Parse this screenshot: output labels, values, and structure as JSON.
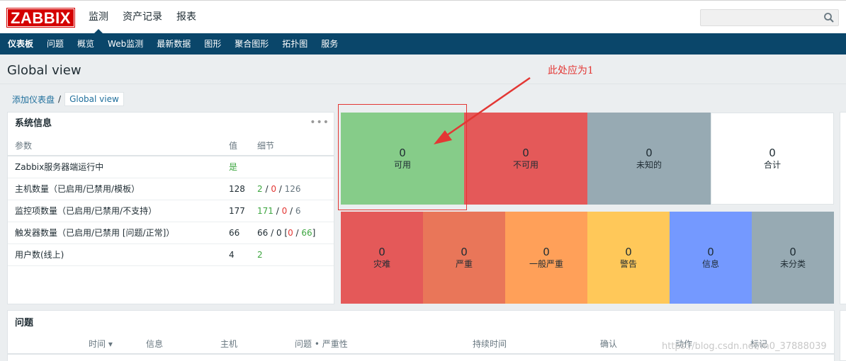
{
  "header": {
    "logo": "ZABBIX",
    "menu": [
      "监测",
      "资产记录",
      "报表"
    ],
    "search_placeholder": ""
  },
  "submenu": [
    "仪表板",
    "问题",
    "概览",
    "Web监测",
    "最新数据",
    "图形",
    "聚合图形",
    "拓扑图",
    "服务"
  ],
  "page": {
    "title": "Global view",
    "breadcrumb_link": "添加仪表盘",
    "breadcrumb_sep": "/",
    "breadcrumb_current": "Global view"
  },
  "system_info": {
    "title": "系统信息",
    "columns": [
      "参数",
      "值",
      "细节"
    ],
    "rows": [
      {
        "param": "Zabbix服务器端运行中",
        "value": "是",
        "d1": "",
        "s1": "",
        "d2": "",
        "s2": "",
        "d3": "",
        "tail": ""
      },
      {
        "param": "主机数量（已启用/已禁用/模板）",
        "value": "128",
        "d1": "2",
        "s1": " / ",
        "d2": "0",
        "s2": " / ",
        "d3": "126",
        "tail": ""
      },
      {
        "param": "监控项数量（已启用/已禁用/不支持）",
        "value": "177",
        "d1": "171",
        "s1": " / ",
        "d2": "0",
        "s2": " / ",
        "d3": "6",
        "tail": ""
      },
      {
        "param": "触发器数量（已启用/已禁用 [问题/正常]）",
        "value": "66",
        "d1": "66 / 0 [",
        "s1": "",
        "d2": "0",
        "s2": " / ",
        "d3": "66",
        "tail": "]"
      },
      {
        "param": "用户数(线上)",
        "value": "4",
        "d1": "2",
        "s1": "",
        "d2": "",
        "s2": "",
        "d3": "",
        "tail": ""
      }
    ]
  },
  "host_availability": [
    {
      "count": "0",
      "label": "可用",
      "color": "#86cc89"
    },
    {
      "count": "0",
      "label": "不可用",
      "color": "#e45959"
    },
    {
      "count": "0",
      "label": "未知的",
      "color": "#97aab3"
    },
    {
      "count": "0",
      "label": "合计",
      "color": "#ffffff"
    }
  ],
  "severity": [
    {
      "count": "0",
      "label": "灾难",
      "color": "#e45959"
    },
    {
      "count": "0",
      "label": "严重",
      "color": "#e97659"
    },
    {
      "count": "0",
      "label": "一般严重",
      "color": "#ffa059"
    },
    {
      "count": "0",
      "label": "警告",
      "color": "#ffc859"
    },
    {
      "count": "0",
      "label": "信息",
      "color": "#7499ff"
    },
    {
      "count": "0",
      "label": "未分类",
      "color": "#97aab3"
    }
  ],
  "problems": {
    "title": "问题",
    "columns": [
      "时间 ▾",
      "信息",
      "主机",
      "问题 • 严重性",
      "持续时间",
      "确认",
      "动作",
      "标记"
    ]
  },
  "annotation": "此处应为1",
  "watermark": "https://blog.csdn.net/m0_37888039"
}
